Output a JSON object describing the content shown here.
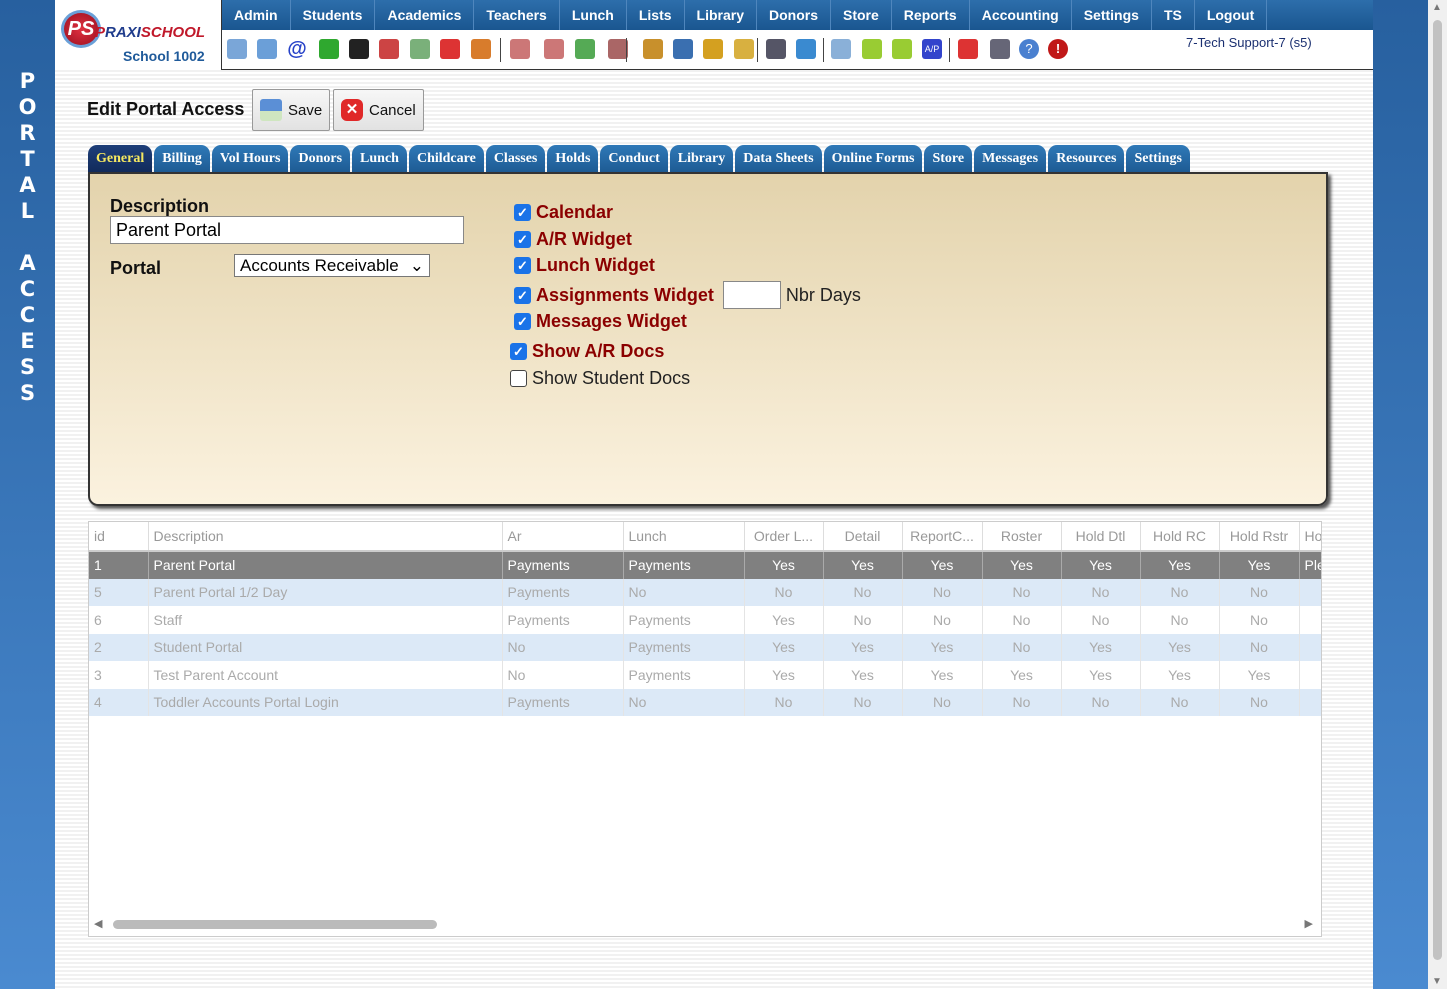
{
  "sidebar": {
    "vertical_title": [
      "P",
      "O",
      "R",
      "T",
      "A",
      "L",
      "",
      "A",
      "C",
      "C",
      "E",
      "S",
      "S"
    ]
  },
  "logo": {
    "brand_a": "P",
    "brand_b": "RAXI",
    "brand_c": "SCHOOL",
    "school": "School 1002"
  },
  "nav": [
    "Admin",
    "Students",
    "Academics",
    "Teachers",
    "Lunch",
    "Lists",
    "Library",
    "Donors",
    "Store",
    "Reports",
    "Accounting",
    "Settings",
    "TS",
    "Logout"
  ],
  "toolbar_icons": [
    "search-icon",
    "calendar-grid-icon",
    "email-icon",
    "chat-icon",
    "phone-icon",
    "speaker-icon",
    "schedule-icon",
    "calendar-icon",
    "megaphone-icon",
    "add-student-icon",
    "student-icon",
    "money-icon",
    "parents-icon",
    "lunch-icon",
    "book-icon",
    "bell-icon",
    "export-icon",
    "teacher-icon",
    "alarm-clock-icon",
    "spreadsheet-icon",
    "check-icon",
    "print-check-icon",
    "ap-icon",
    "pdf-icon",
    "cash-register-icon",
    "help-icon",
    "stop-icon"
  ],
  "user": "7-Tech Support-7 (s5)",
  "page": {
    "title": "Edit Portal Access",
    "save": "Save",
    "cancel": "Cancel"
  },
  "tabs": [
    "General",
    "Billing",
    "Vol Hours",
    "Donors",
    "Lunch",
    "Childcare",
    "Classes",
    "Holds",
    "Conduct",
    "Library",
    "Data Sheets",
    "Online Forms",
    "Store",
    "Messages",
    "Resources",
    "Settings"
  ],
  "form": {
    "description_label": "Description",
    "description_value": "Parent Portal",
    "portal_label": "Portal",
    "portal_value": "Accounts Receivable",
    "checkboxes": [
      {
        "label": "Calendar",
        "checked": true
      },
      {
        "label": "A/R Widget",
        "checked": true
      },
      {
        "label": "Lunch Widget",
        "checked": true
      },
      {
        "label": "Assignments Widget",
        "checked": true
      },
      {
        "label": "Messages Widget",
        "checked": true
      },
      {
        "label": "Show A/R Docs",
        "checked": true
      },
      {
        "label": "Show Student Docs",
        "checked": false
      }
    ],
    "nbr_days_label": "Nbr Days",
    "nbr_days_value": ""
  },
  "grid": {
    "columns": [
      "id",
      "Description",
      "Ar",
      "Lunch",
      "Order L...",
      "Detail",
      "ReportC...",
      "Roster",
      "Hold Dtl",
      "Hold RC",
      "Hold Rstr",
      "Ho"
    ],
    "rows": [
      [
        "1",
        "Parent Portal",
        "Payments",
        "Payments",
        "Yes",
        "Yes",
        "Yes",
        "Yes",
        "Yes",
        "Yes",
        "Yes",
        "Ple"
      ],
      [
        "5",
        "Parent Portal 1/2 Day",
        "Payments",
        "No",
        "No",
        "No",
        "No",
        "No",
        "No",
        "No",
        "No",
        ""
      ],
      [
        "6",
        "Staff",
        "Payments",
        "Payments",
        "Yes",
        "No",
        "No",
        "No",
        "No",
        "No",
        "No",
        ""
      ],
      [
        "2",
        "Student Portal",
        "No",
        "Payments",
        "Yes",
        "Yes",
        "Yes",
        "No",
        "Yes",
        "Yes",
        "No",
        ""
      ],
      [
        "3",
        "Test Parent Account",
        "No",
        "Payments",
        "Yes",
        "Yes",
        "Yes",
        "Yes",
        "Yes",
        "Yes",
        "Yes",
        ""
      ],
      [
        "4",
        "Toddler Accounts Portal Login",
        "Payments",
        "No",
        "No",
        "No",
        "No",
        "No",
        "No",
        "No",
        "No",
        ""
      ]
    ],
    "selected_row": 0
  }
}
